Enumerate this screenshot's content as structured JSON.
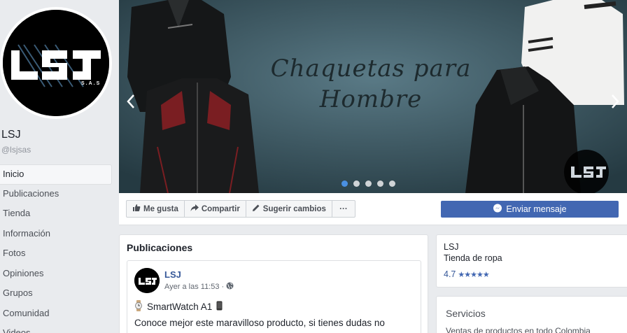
{
  "page": {
    "name": "LSJ",
    "handle": "@lsjsas"
  },
  "logo": {
    "text": "LSJ",
    "subtext": "S.A.S"
  },
  "nav": {
    "items": [
      "Inicio",
      "Publicaciones",
      "Tienda",
      "Información",
      "Fotos",
      "Opiniones",
      "Grupos",
      "Comunidad",
      "Videos"
    ],
    "active": "Inicio"
  },
  "cover": {
    "title_line1": "Chaquetas para",
    "title_line2": "Hombre",
    "slide_count": 5,
    "active_slide": 1
  },
  "actions": {
    "like": "Me gusta",
    "share": "Compartir",
    "suggest": "Sugerir cambios",
    "more": "···",
    "send_message": "Enviar mensaje"
  },
  "posts": {
    "title": "Publicaciones",
    "post": {
      "author": "LSJ",
      "time": "Ayer a las 11:53",
      "product": "SmartWatch A1",
      "text": "Conoce mejor este maravilloso producto, si tienes dudas no"
    }
  },
  "info": {
    "name": "LSJ",
    "category": "Tienda de ropa",
    "rating": "4.7",
    "stars": "★★★★★"
  },
  "services": {
    "title": "Servicios",
    "text": "Ventas de productos en todo Colombia"
  },
  "colors": {
    "facebook_blue": "#4267b2",
    "link_blue": "#365899",
    "background": "#e9ebee",
    "cover_bg": "#3a5560"
  }
}
